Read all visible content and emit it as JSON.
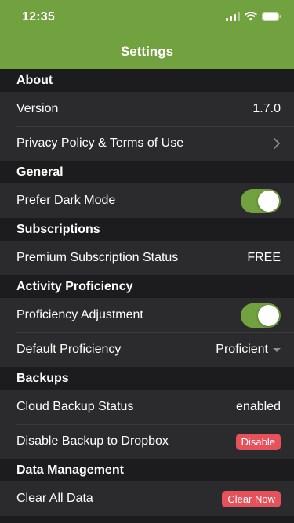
{
  "status_bar": {
    "time": "12:35"
  },
  "nav": {
    "title": "Settings"
  },
  "colors": {
    "header": "#72a140",
    "toggle_on": "#72a140",
    "danger": "#e5525b"
  },
  "sections": {
    "about": {
      "title": "About",
      "version_label": "Version",
      "version_value": "1.7.0",
      "privacy_label": "Privacy Policy & Terms of Use"
    },
    "general": {
      "title": "General",
      "dark_mode_label": "Prefer Dark Mode",
      "dark_mode_on": true
    },
    "subscriptions": {
      "title": "Subscriptions",
      "status_label": "Premium Subscription Status",
      "status_value": "FREE"
    },
    "activity": {
      "title": "Activity Proficiency",
      "adjustment_label": "Proficiency Adjustment",
      "adjustment_on": true,
      "default_label": "Default Proficiency",
      "default_value": "Proficient"
    },
    "backups": {
      "title": "Backups",
      "cloud_label": "Cloud Backup Status",
      "cloud_value": "enabled",
      "dropbox_label": "Disable Backup to Dropbox",
      "dropbox_button": "Disable"
    },
    "data": {
      "title": "Data Management",
      "clear_label": "Clear All Data",
      "clear_button": "Clear Now"
    }
  }
}
